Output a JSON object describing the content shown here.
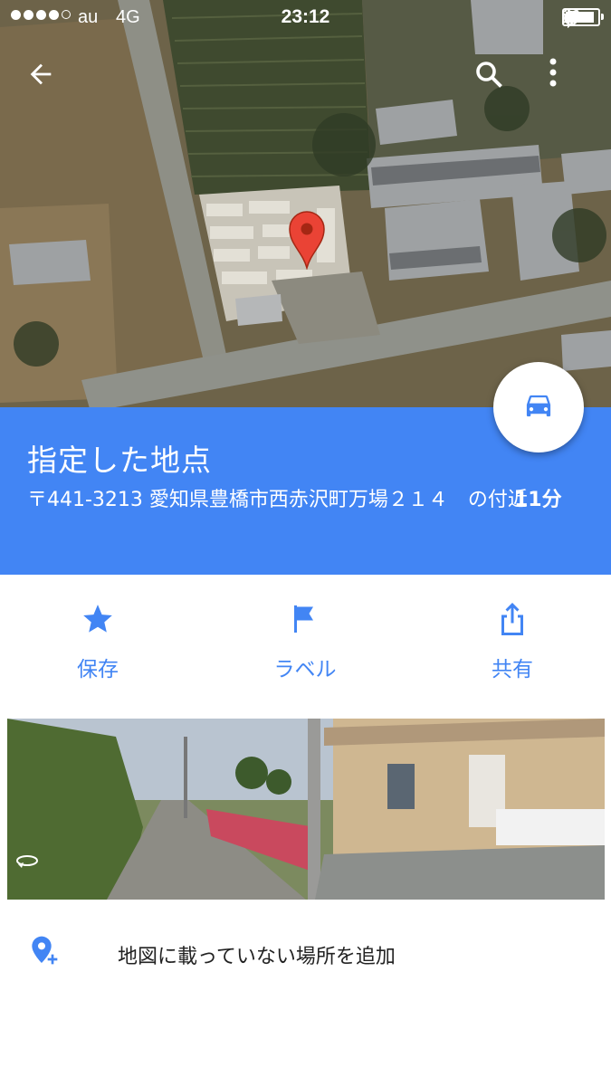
{
  "status_bar": {
    "carrier": "au",
    "network": "4G",
    "time": "23:12",
    "signal_bars_filled": 4,
    "signal_bars_total": 5,
    "battery_level": 0.9
  },
  "map": {
    "back_icon": "arrow-left-icon",
    "search_icon": "search-icon",
    "menu_icon": "more-vert-icon",
    "pin_color": "#ea4335"
  },
  "place": {
    "title": "指定した地点",
    "address": "〒441-3213 愛知県豊橋市西赤沢町万場２１４　の付近",
    "eta": "11分",
    "directions_icon": "car-icon"
  },
  "actions": [
    {
      "label": "保存",
      "icon": "star-icon"
    },
    {
      "label": "ラベル",
      "icon": "flag-icon"
    },
    {
      "label": "共有",
      "icon": "share-icon"
    }
  ],
  "street_view": {
    "icon": "rotate-360-icon"
  },
  "add_place": {
    "label": "地図に載っていない場所を追加",
    "icon": "add-location-icon"
  },
  "colors": {
    "accent": "#4285f4",
    "white": "#ffffff"
  }
}
